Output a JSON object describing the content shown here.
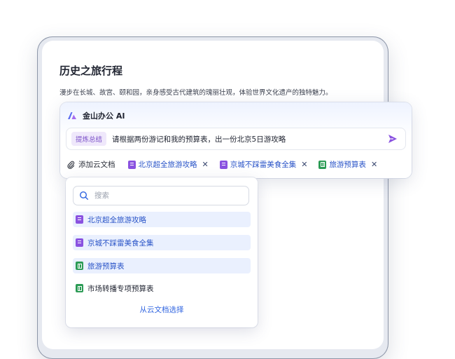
{
  "document": {
    "title": "历史之旅行程",
    "description": "漫步在长城、故宫、颐和园，亲身感受古代建筑的瑰丽壮观，体验世界文化遗产的独特魅力。"
  },
  "ai_panel": {
    "app_name": "金山办公 AI",
    "tag": "提炼总结",
    "prompt": "请根据两份游记和我的预算表，出一份北京5日游攻略",
    "add_cloud_doc": "添加云文档",
    "attachments": [
      {
        "name": "北京超全旅游攻略",
        "type": "doc"
      },
      {
        "name": "京城不踩雷美食全集",
        "type": "doc"
      },
      {
        "name": "旅游预算表",
        "type": "sheet"
      }
    ],
    "remove_symbol": "✕"
  },
  "dropdown": {
    "search_placeholder": "搜索",
    "items": [
      {
        "name": "北京超全旅游攻略",
        "type": "doc",
        "selected": true
      },
      {
        "name": "京城不踩雷美食全集",
        "type": "doc",
        "selected": true
      },
      {
        "name": "旅游预算表",
        "type": "sheet",
        "selected": true
      },
      {
        "name": "市场转播专项预算表",
        "type": "sheet",
        "selected": false
      }
    ],
    "footer_link": "从云文档选择"
  },
  "icons": {
    "logo": "kingsoft-ai-logo-icon",
    "send": "send-arrow-icon",
    "attach": "paperclip-icon",
    "search": "search-icon",
    "doc": "document-file-icon",
    "sheet": "spreadsheet-file-icon"
  },
  "colors": {
    "accent_purple": "#8a52e0",
    "link_blue": "#2f64e0",
    "sheet_green": "#2c9b55",
    "selected_bg": "#eaf0fe"
  }
}
